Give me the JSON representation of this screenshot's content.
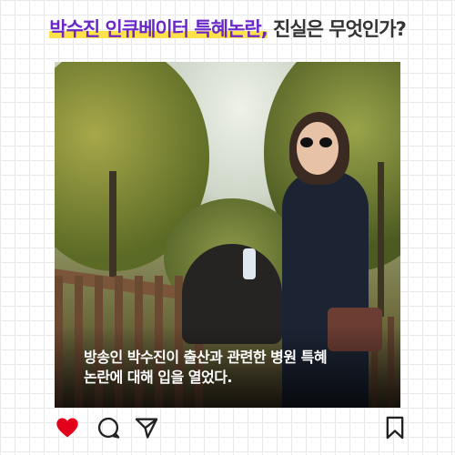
{
  "headline": {
    "highlighted": "박수진 인큐베이터 특혜논란,",
    "rest": " 진실은 무엇인가?"
  },
  "post": {
    "caption_line1": "방송인 박수진이 출산과 관련한 병원 특혜",
    "caption_line2": "논란에 대해 입을 열었다."
  },
  "actions": {
    "like_icon": "heart-icon",
    "comment_icon": "comment-icon",
    "share_icon": "send-icon",
    "save_icon": "bookmark-icon"
  },
  "colors": {
    "headline_accent": "#6a28c9",
    "highlight": "#ffe24a",
    "like": "#e3001b"
  }
}
